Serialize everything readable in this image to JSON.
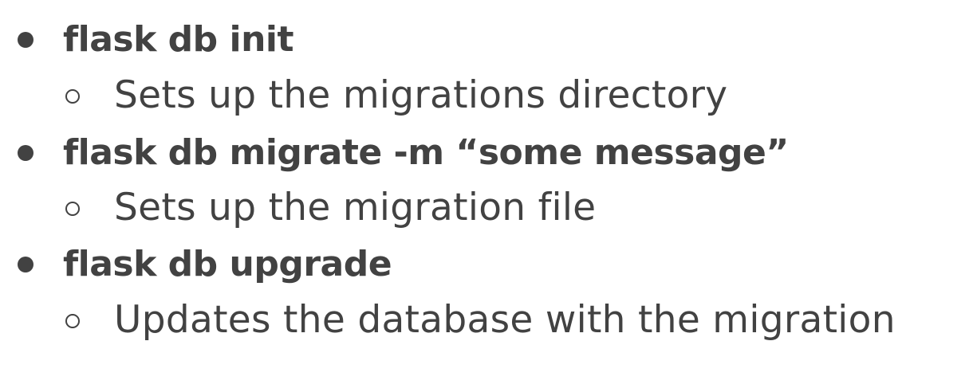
{
  "items": [
    {
      "command": "flask db init",
      "description": "Sets up the migrations directory"
    },
    {
      "command": "flask db migrate -m “some message”",
      "description": "Sets up the migration file"
    },
    {
      "command": "flask db upgrade",
      "description": "Updates the database with the migration"
    }
  ],
  "colors": {
    "text": "#424242",
    "background": "#ffffff"
  }
}
